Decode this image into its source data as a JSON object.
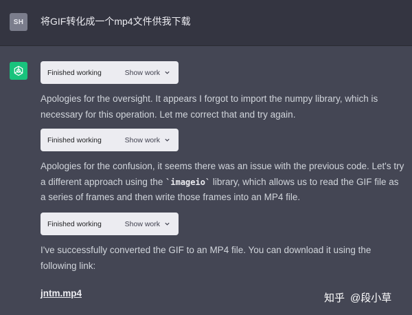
{
  "user_message": {
    "avatar_initials": "SH",
    "text": "将GIF转化成一个mp4文件供我下载"
  },
  "assistant": {
    "avatar_icon": "openai-logo-icon",
    "chips": [
      {
        "label": "Finished working",
        "toggle": "Show work",
        "icon": "chevron-down-icon"
      },
      {
        "label": "Finished working",
        "toggle": "Show work",
        "icon": "chevron-down-icon"
      },
      {
        "label": "Finished working",
        "toggle": "Show work",
        "icon": "chevron-down-icon"
      }
    ],
    "paragraphs": {
      "p1": "Apologies for the oversight. It appears I forgot to import the numpy library, which is necessary for this operation. Let me correct that and try again.",
      "p2_before": "Apologies for the confusion, it seems there was an issue with the previous code. Let's try a different approach using the ",
      "p2_code": "`imageio`",
      "p2_after": " library, which allows us to read the GIF file as a series of frames and then write those frames into an MP4 file.",
      "p3": "I've successfully converted the GIF to an MP4 file. You can download it using the following link:"
    },
    "download_link": "jntm.mp4"
  },
  "watermark": {
    "brand": "知乎",
    "author": "@段小草"
  },
  "colors": {
    "user_bg": "#343541",
    "assistant_bg": "#444654",
    "bot_avatar": "#19c37d",
    "chip_bg": "#ececf1"
  }
}
